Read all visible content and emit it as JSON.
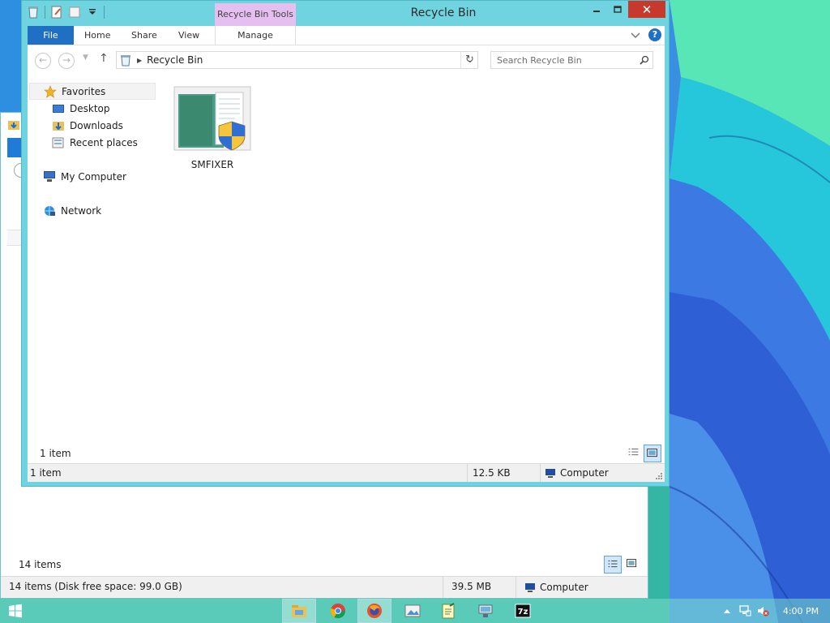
{
  "window": {
    "title": "Recycle Bin",
    "contextual_tab_group": "Recycle Bin Tools",
    "tabs": [
      "File",
      "Home",
      "Share",
      "View",
      "Manage"
    ],
    "close_label": "✕"
  },
  "address_bar": {
    "path": "Recycle Bin",
    "search_placeholder": "Search Recycle Bin"
  },
  "navigation_pane": {
    "favorites": "Favorites",
    "items": [
      "Desktop",
      "Downloads",
      "Recent places"
    ],
    "computer": "My Computer",
    "network": "Network"
  },
  "files": [
    {
      "name": "SMFIXER",
      "icon": "installer-shield-icon"
    }
  ],
  "item_count": "1 item",
  "status_bar": {
    "items": "1 item",
    "size": "12.5 KB",
    "location": "Computer"
  },
  "background_window": {
    "item_count": "14 items",
    "status": "14 items (Disk free space: 99.0 GB)",
    "size": "39.5 MB",
    "location": "Computer"
  },
  "taskbar": {
    "apps": [
      "file-explorer-icon",
      "chrome-icon",
      "firefox-icon",
      "photo-viewer-icon",
      "notepad-icon",
      "network-tool-icon",
      "7zip-icon"
    ],
    "sevenzip_label": "7z",
    "clock": "4:00 PM"
  },
  "colors": {
    "window_frame": "#6fd4df",
    "file_tab": "#1f6fc5",
    "tools_tab": "#e5bff0",
    "close_button": "#c7392a"
  }
}
